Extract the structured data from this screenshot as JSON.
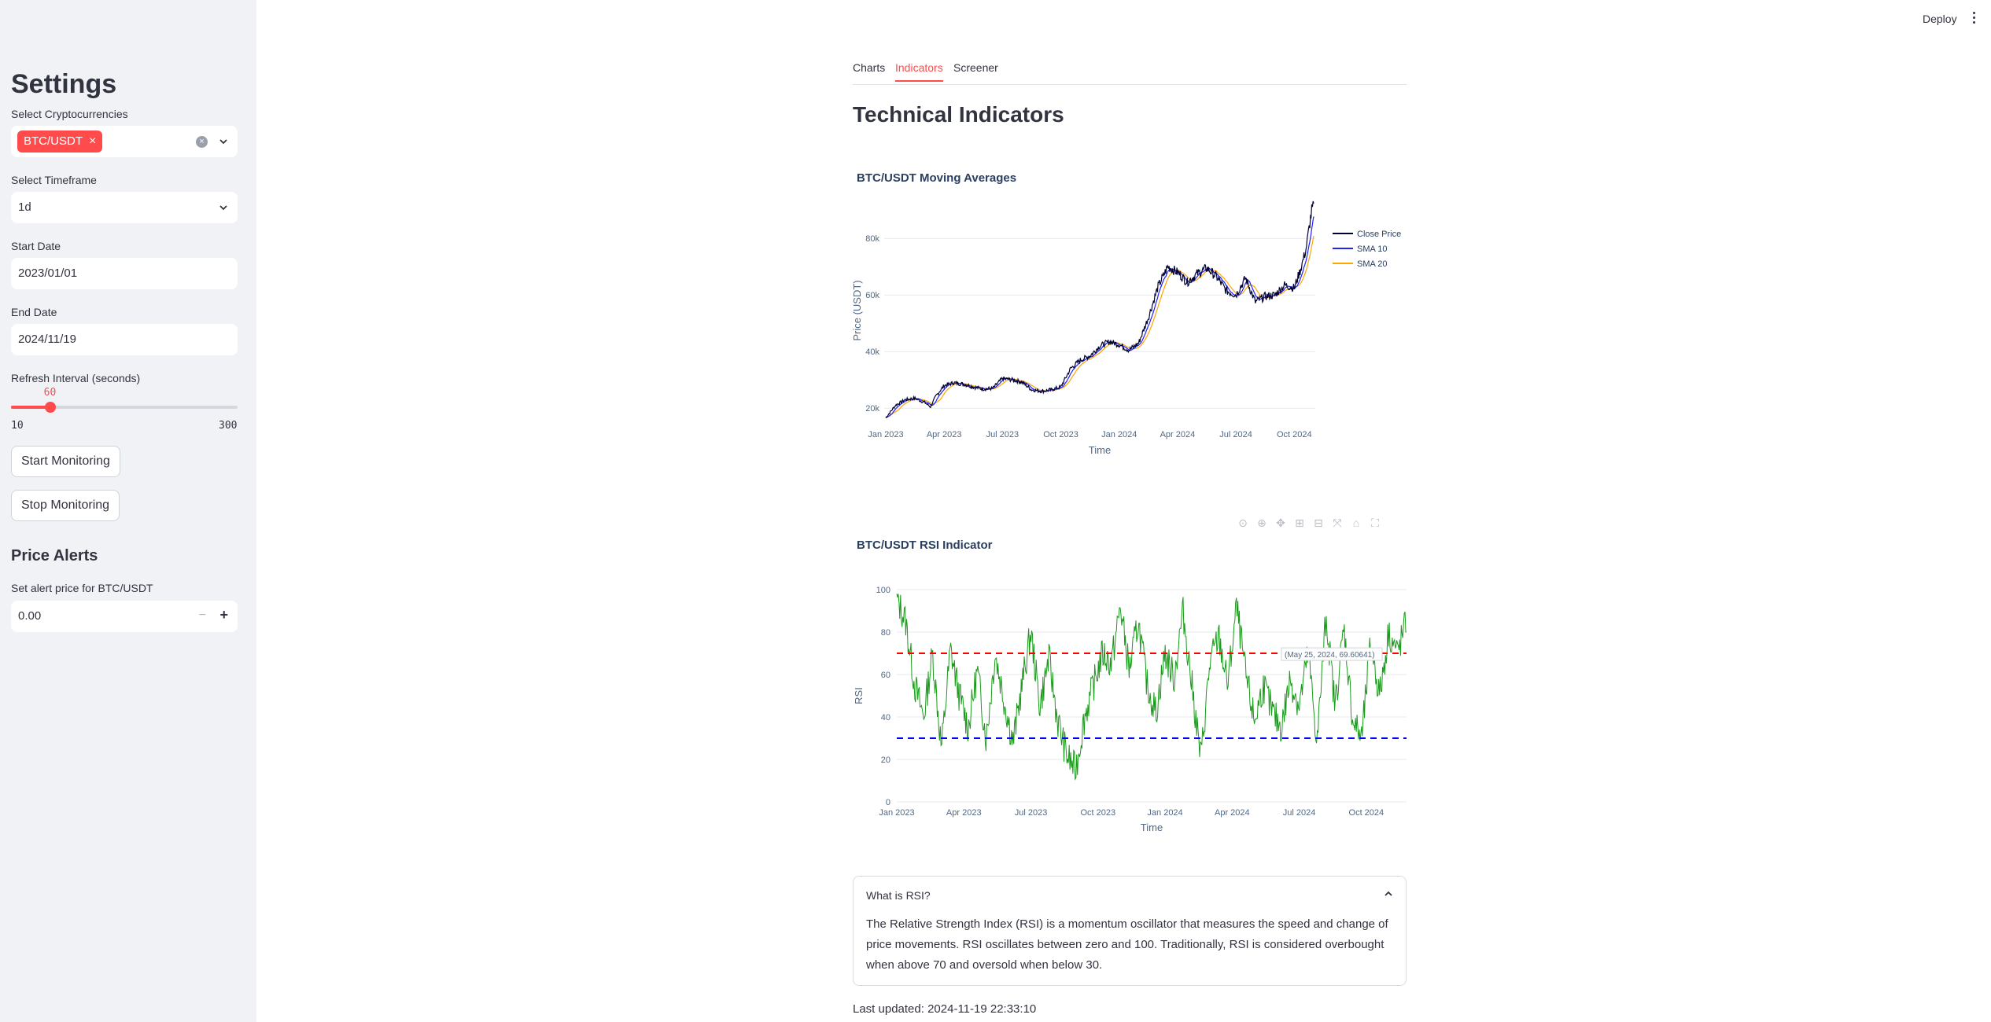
{
  "header": {
    "deploy_label": "Deploy"
  },
  "sidebar": {
    "title": "Settings",
    "crypto_label": "Select Cryptocurrencies",
    "crypto_selected": "BTC/USDT",
    "timeframe_label": "Select Timeframe",
    "timeframe_value": "1d",
    "start_date_label": "Start Date",
    "start_date_value": "2023/01/01",
    "end_date_label": "End Date",
    "end_date_value": "2024/11/19",
    "refresh_label": "Refresh Interval (seconds)",
    "refresh_value": "60",
    "refresh_min": "10",
    "refresh_max": "300",
    "start_button": "Start Monitoring",
    "stop_button": "Stop Monitoring",
    "alerts_title": "Price Alerts",
    "alert_label": "Set alert price for BTC/USDT",
    "alert_value": "0.00"
  },
  "tabs": [
    "Charts",
    "Indicators",
    "Screener"
  ],
  "active_tab": "Indicators",
  "page_title": "Technical Indicators",
  "chart_data": [
    {
      "type": "line",
      "title": "BTC/USDT Moving Averages",
      "xlabel": "Time",
      "ylabel": "Price (USDT)",
      "x_ticks": [
        "Jan 2023",
        "Apr 2023",
        "Jul 2023",
        "Oct 2023",
        "Jan 2024",
        "Apr 2024",
        "Jul 2024",
        "Oct 2024"
      ],
      "y_ticks": [
        "20k",
        "40k",
        "60k",
        "80k"
      ],
      "ylim": [
        17000,
        92000
      ],
      "x_months": [
        0,
        3,
        6,
        9,
        12,
        15,
        18,
        21
      ],
      "series": [
        {
          "name": "Close Price",
          "color": "#000033"
        },
        {
          "name": "SMA 10",
          "color": "#1f1fff"
        },
        {
          "name": "SMA 20",
          "color": "#ffa500"
        }
      ],
      "anchors": [
        [
          0,
          16600
        ],
        [
          0.5,
          21000
        ],
        [
          1,
          23000
        ],
        [
          1.5,
          23500
        ],
        [
          2,
          22000
        ],
        [
          2.3,
          20500
        ],
        [
          2.6,
          24500
        ],
        [
          3,
          28000
        ],
        [
          3.5,
          29000
        ],
        [
          4,
          28500
        ],
        [
          4.5,
          27500
        ],
        [
          5,
          26800
        ],
        [
          5.5,
          27000
        ],
        [
          6,
          30500
        ],
        [
          6.5,
          30000
        ],
        [
          7,
          29200
        ],
        [
          7.5,
          26500
        ],
        [
          8,
          26000
        ],
        [
          8.5,
          26500
        ],
        [
          9,
          27500
        ],
        [
          9.5,
          34000
        ],
        [
          10,
          37000
        ],
        [
          10.5,
          38500
        ],
        [
          11,
          42000
        ],
        [
          11.5,
          43500
        ],
        [
          12,
          42500
        ],
        [
          12.5,
          40500
        ],
        [
          13,
          43000
        ],
        [
          13.5,
          52000
        ],
        [
          14,
          63000
        ],
        [
          14.5,
          70000
        ],
        [
          15,
          68000
        ],
        [
          15.5,
          64500
        ],
        [
          16,
          67500
        ],
        [
          16.5,
          69500
        ],
        [
          17,
          66500
        ],
        [
          17.5,
          61500
        ],
        [
          18,
          60000
        ],
        [
          18.5,
          66000
        ],
        [
          19,
          57500
        ],
        [
          19.5,
          59500
        ],
        [
          20,
          60000
        ],
        [
          20.5,
          63500
        ],
        [
          21,
          62500
        ],
        [
          21.3,
          68500
        ],
        [
          21.6,
          76000
        ],
        [
          21.9,
          90000
        ],
        [
          22,
          91500
        ]
      ]
    },
    {
      "type": "line",
      "title": "BTC/USDT RSI Indicator",
      "xlabel": "Time",
      "ylabel": "RSI",
      "x_ticks": [
        "Jan 2023",
        "Apr 2023",
        "Jul 2023",
        "Oct 2023",
        "Jan 2024",
        "Apr 2024",
        "Jul 2024",
        "Oct 2024"
      ],
      "y_ticks": [
        "0",
        "20",
        "40",
        "60",
        "80",
        "100"
      ],
      "ylim": [
        0,
        100
      ],
      "x_months": [
        0,
        3,
        6,
        9,
        12,
        15,
        18,
        21
      ],
      "overbought": 70,
      "oversold": 30,
      "series": [
        {
          "name": "RSI",
          "color": "#1a9a1a"
        },
        {
          "name": "Overbought",
          "color": "#ff0000"
        },
        {
          "name": "Oversold",
          "color": "#0000ff"
        }
      ],
      "hover_label": "(May 25, 2024, 69.60641)",
      "anchors": [
        [
          0,
          96
        ],
        [
          0.4,
          85
        ],
        [
          0.8,
          55
        ],
        [
          1.2,
          40
        ],
        [
          1.6,
          70
        ],
        [
          2,
          25
        ],
        [
          2.4,
          72
        ],
        [
          2.8,
          50
        ],
        [
          3.2,
          35
        ],
        [
          3.6,
          62
        ],
        [
          4,
          30
        ],
        [
          4.4,
          70
        ],
        [
          4.8,
          48
        ],
        [
          5.2,
          28
        ],
        [
          5.6,
          55
        ],
        [
          6,
          80
        ],
        [
          6.4,
          45
        ],
        [
          6.8,
          68
        ],
        [
          7.2,
          38
        ],
        [
          7.6,
          22
        ],
        [
          8,
          15
        ],
        [
          8.4,
          40
        ],
        [
          8.8,
          55
        ],
        [
          9.2,
          70
        ],
        [
          9.6,
          65
        ],
        [
          10,
          92
        ],
        [
          10.4,
          62
        ],
        [
          10.8,
          85
        ],
        [
          11.2,
          55
        ],
        [
          11.6,
          42
        ],
        [
          12,
          70
        ],
        [
          12.4,
          58
        ],
        [
          12.8,
          90
        ],
        [
          13.2,
          55
        ],
        [
          13.6,
          20
        ],
        [
          14,
          65
        ],
        [
          14.4,
          78
        ],
        [
          14.8,
          55
        ],
        [
          15.2,
          92
        ],
        [
          15.6,
          60
        ],
        [
          16,
          38
        ],
        [
          16.4,
          55
        ],
        [
          16.8,
          42
        ],
        [
          17.2,
          35
        ],
        [
          17.6,
          58
        ],
        [
          18,
          45
        ],
        [
          18.4,
          70
        ],
        [
          18.8,
          28
        ],
        [
          19.2,
          88
        ],
        [
          19.6,
          45
        ],
        [
          20,
          82
        ],
        [
          20.4,
          38
        ],
        [
          20.8,
          30
        ],
        [
          21.2,
          75
        ],
        [
          21.6,
          50
        ],
        [
          22,
          80
        ],
        [
          22.4,
          70
        ],
        [
          22.8,
          85
        ]
      ]
    }
  ],
  "expander": {
    "title": "What is RSI?",
    "body": "The Relative Strength Index (RSI) is a momentum oscillator that measures the speed and change of price movements. RSI oscillates between zero and 100. Traditionally, RSI is considered overbought when above 70 and oversold when below 30."
  },
  "last_updated": "Last updated: 2024-11-19 22:33:10"
}
